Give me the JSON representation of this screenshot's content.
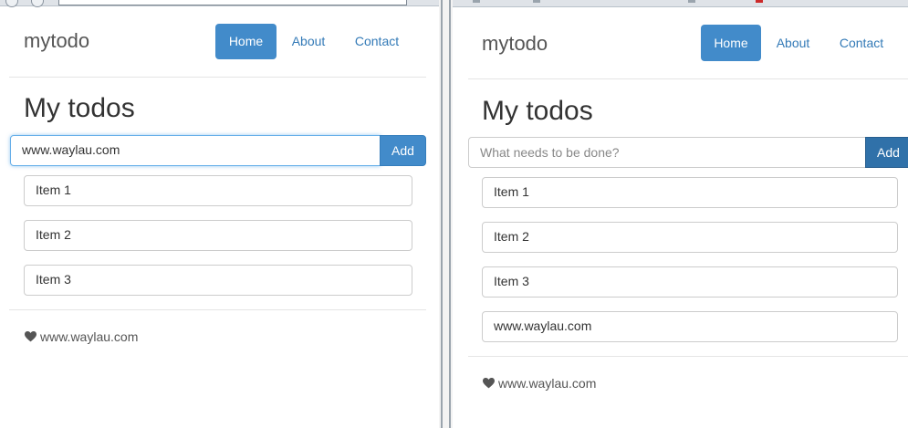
{
  "left_pane": {
    "brand": "mytodo",
    "nav": {
      "home": "Home",
      "about": "About",
      "contact": "Contact"
    },
    "title": "My todos",
    "input_value": "www.waylau.com",
    "add_label": "Add",
    "items": [
      "Item 1",
      "Item 2",
      "Item 3"
    ],
    "footer_text": "www.waylau.com"
  },
  "right_pane": {
    "brand": "mytodo",
    "nav": {
      "home": "Home",
      "about": "About",
      "contact": "Contact"
    },
    "title": "My todos",
    "input_placeholder": "What needs to be done?",
    "add_label": "Add",
    "items": [
      "Item 1",
      "Item 2",
      "Item 3",
      "www.waylau.com"
    ],
    "footer_text": "www.waylau.com"
  },
  "icons": {
    "footer_icon": "heart-icon"
  },
  "colors": {
    "accent": "#428bca",
    "accent_pressed": "#3071a9",
    "link": "#337ab7",
    "focus": "#66afe9",
    "text": "#333333",
    "border": "#cccccc"
  }
}
